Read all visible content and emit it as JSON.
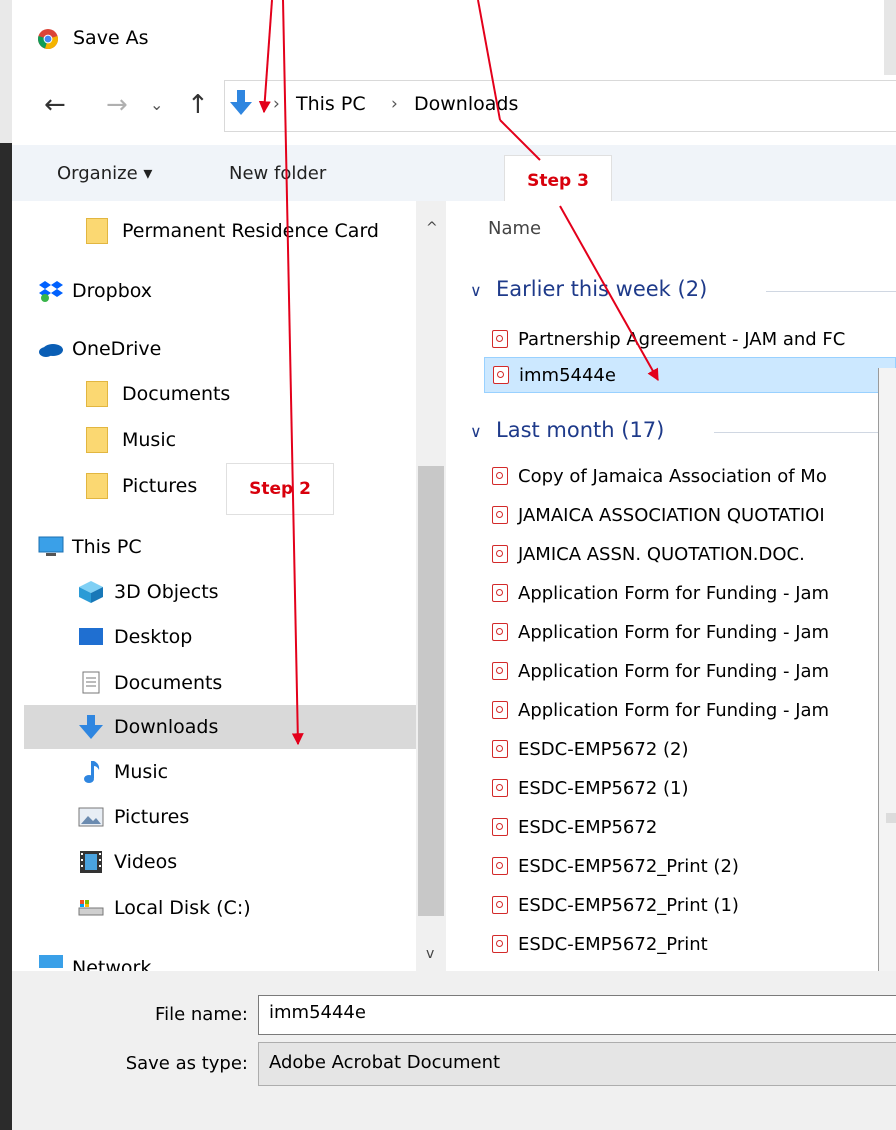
{
  "window": {
    "title": "Save As"
  },
  "nav": {
    "back": "←",
    "forward": "→",
    "recent": "⌄",
    "up": "↑",
    "breadcrumb": [
      "This PC",
      "Downloads"
    ],
    "separator": "›"
  },
  "commands": {
    "organize": "Organize ▾",
    "new_folder": "New folder"
  },
  "callouts": {
    "step3": "Step 3",
    "step2": "Step 2"
  },
  "sidebar": {
    "items": [
      {
        "label": "Permanent Residence Card",
        "icon": "folder-icon"
      },
      {
        "label": "Dropbox",
        "icon": "dropbox-icon"
      },
      {
        "label": "OneDrive",
        "icon": "onedrive-icon"
      },
      {
        "label": "Documents",
        "icon": "folder-icon"
      },
      {
        "label": "Music",
        "icon": "folder-icon"
      },
      {
        "label": "Pictures",
        "icon": "folder-icon"
      },
      {
        "label": "This PC",
        "icon": "computer-icon"
      },
      {
        "label": "3D Objects",
        "icon": "cube-icon"
      },
      {
        "label": "Desktop",
        "icon": "desktop-icon"
      },
      {
        "label": "Documents",
        "icon": "documents-icon"
      },
      {
        "label": "Downloads",
        "icon": "download-arrow-icon",
        "selected": true
      },
      {
        "label": "Music",
        "icon": "music-note-icon"
      },
      {
        "label": "Pictures",
        "icon": "pictures-icon"
      },
      {
        "label": "Videos",
        "icon": "film-icon"
      },
      {
        "label": "Local Disk (C:)",
        "icon": "drive-icon"
      },
      {
        "label": "Network",
        "icon": "network-icon"
      }
    ],
    "scroll_up": "^",
    "scroll_down": "v"
  },
  "files": {
    "column_name": "Name",
    "groups": [
      {
        "title": "Earlier this week (2)",
        "items": [
          {
            "name": "Partnership Agreement - JAM and FC"
          },
          {
            "name": "imm5444e",
            "selected": true
          }
        ]
      },
      {
        "title": "Last month (17)",
        "items": [
          {
            "name": "Copy of Jamaica Association of Mo"
          },
          {
            "name": "JAMAICA ASSOCIATION QUOTATIOI"
          },
          {
            "name": "JAMICA ASSN. QUOTATION.DOC."
          },
          {
            "name": "Application Form for Funding - Jam"
          },
          {
            "name": "Application Form for Funding - Jam"
          },
          {
            "name": "Application Form for Funding - Jam"
          },
          {
            "name": "Application Form for Funding - Jam"
          },
          {
            "name": "ESDC-EMP5672 (2)"
          },
          {
            "name": "ESDC-EMP5672 (1)"
          },
          {
            "name": "ESDC-EMP5672"
          },
          {
            "name": "ESDC-EMP5672_Print (2)"
          },
          {
            "name": "ESDC-EMP5672_Print (1)"
          },
          {
            "name": "ESDC-EMP5672_Print"
          }
        ]
      }
    ]
  },
  "form": {
    "file_name_label": "File name:",
    "file_name_value": "imm5444e",
    "save_type_label": "Save as type:",
    "save_type_value": "Adobe Acrobat Document"
  },
  "colors": {
    "annotation": "#e3001b",
    "selection": "#cce8ff",
    "group_header": "#1e3a8a"
  }
}
